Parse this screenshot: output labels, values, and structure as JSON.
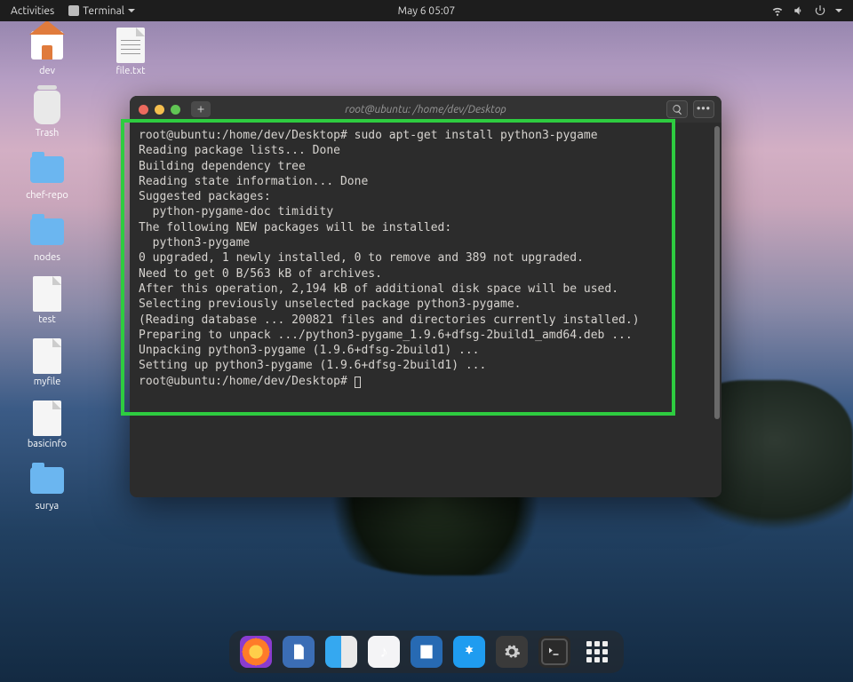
{
  "topbar": {
    "activities": "Activities",
    "app_label": "Terminal",
    "datetime": "May 6  05:07"
  },
  "desktop_icons": [
    {
      "label": "dev",
      "type": "home"
    },
    {
      "label": "file.txt",
      "type": "file-lines"
    },
    {
      "label": "Trash",
      "type": "trash"
    },
    {
      "label": "chef-repo",
      "type": "folder"
    },
    {
      "label": "nodes",
      "type": "folder"
    },
    {
      "label": "test",
      "type": "file"
    },
    {
      "label": "myfile",
      "type": "file"
    },
    {
      "label": "basicinfo",
      "type": "file"
    },
    {
      "label": "surya",
      "type": "folder"
    }
  ],
  "terminal": {
    "title": "root@ubuntu: /home/dev/Desktop",
    "prompt1": "root@ubuntu:/home/dev/Desktop# ",
    "command1": "sudo apt-get install python3-pygame",
    "output_lines": [
      "Reading package lists... Done",
      "Building dependency tree",
      "Reading state information... Done",
      "Suggested packages:",
      "  python-pygame-doc timidity",
      "The following NEW packages will be installed:",
      "  python3-pygame",
      "0 upgraded, 1 newly installed, 0 to remove and 389 not upgraded.",
      "Need to get 0 B/563 kB of archives.",
      "After this operation, 2,194 kB of additional disk space will be used.",
      "Selecting previously unselected package python3-pygame.",
      "(Reading database ... 200821 files and directories currently installed.)",
      "Preparing to unpack .../python3-pygame_1.9.6+dfsg-2build1_amd64.deb ...",
      "Unpacking python3-pygame (1.9.6+dfsg-2build1) ...",
      "Setting up python3-pygame (1.9.6+dfsg-2build1) ..."
    ],
    "prompt2": "root@ubuntu:/home/dev/Desktop# "
  },
  "dock": {
    "apps": [
      "firefox",
      "text-editor",
      "files",
      "music",
      "writer",
      "app-store",
      "settings",
      "terminal",
      "show-apps"
    ]
  }
}
